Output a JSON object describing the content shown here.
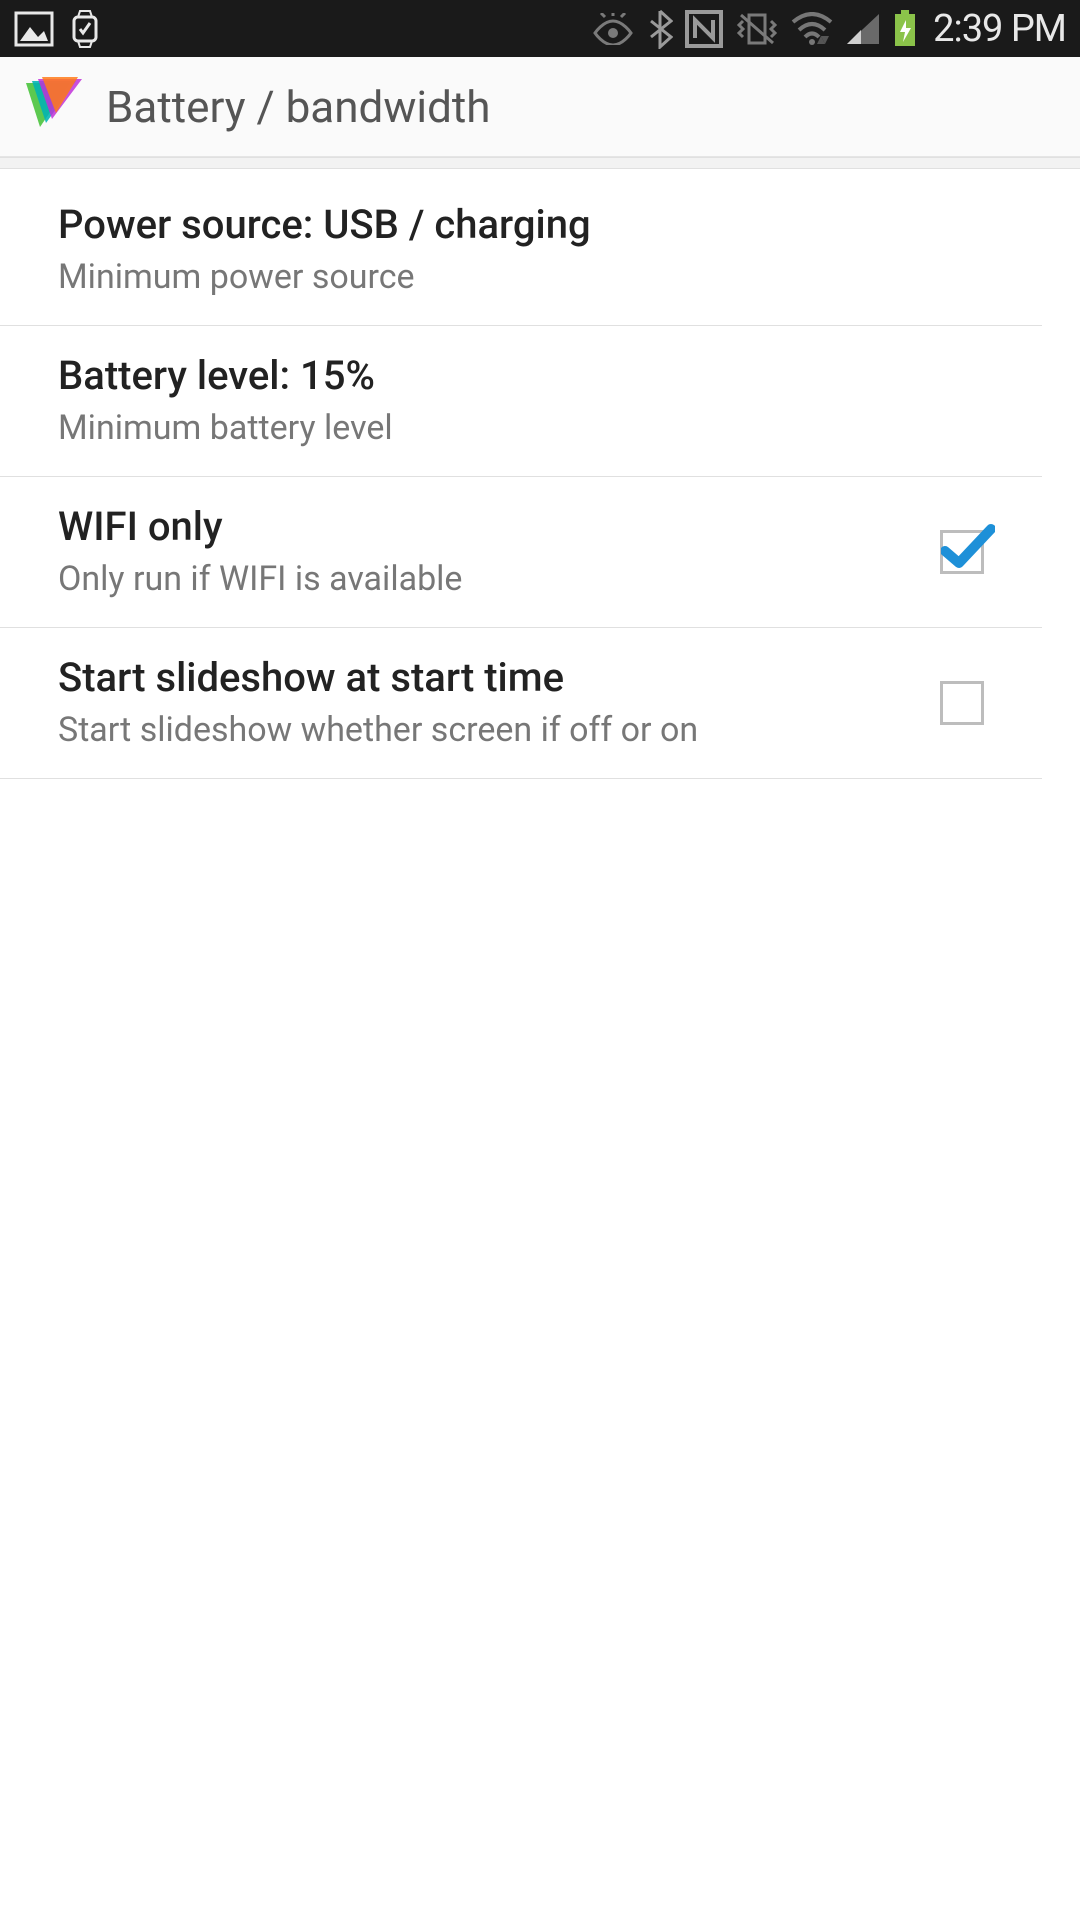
{
  "status": {
    "time": "2:39 PM"
  },
  "header": {
    "title": "Battery / bandwidth"
  },
  "prefs": {
    "power": {
      "title": "Power source: USB / charging",
      "sub": "Minimum power source"
    },
    "battery": {
      "title": "Battery level: 15%",
      "sub": "Minimum battery level"
    },
    "wifi": {
      "title": "WIFI only",
      "sub": "Only run if WIFI is available",
      "checked": true
    },
    "slideshow": {
      "title": "Start slideshow at start time",
      "sub": "Start slideshow whether screen if off or on",
      "checked": false
    }
  }
}
